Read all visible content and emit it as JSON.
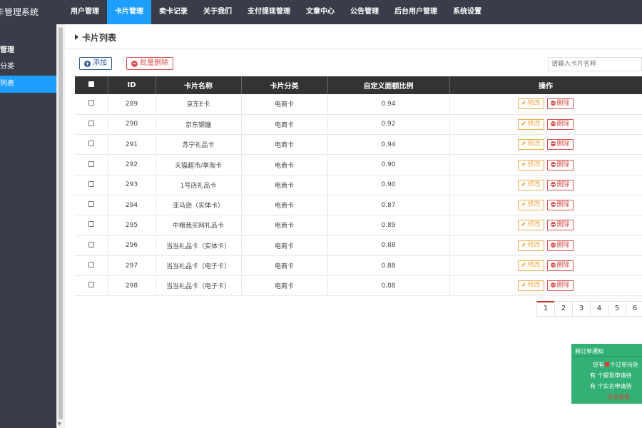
{
  "app": {
    "title": "卡管理系统"
  },
  "nav": {
    "items": [
      {
        "label": "用户管理",
        "active": false
      },
      {
        "label": "卡片管理",
        "active": true
      },
      {
        "label": "卖卡记录",
        "active": false
      },
      {
        "label": "关于我们",
        "active": false
      },
      {
        "label": "支付提现管理",
        "active": false
      },
      {
        "label": "文章中心",
        "active": false
      },
      {
        "label": "公告管理",
        "active": false
      },
      {
        "label": "后台用户管理",
        "active": false
      },
      {
        "label": "系统设置",
        "active": false
      }
    ]
  },
  "sidebar": {
    "group": "管理",
    "items": [
      {
        "label": "分类",
        "active": false
      },
      {
        "label": "列表",
        "active": true
      }
    ]
  },
  "main": {
    "title": "卡片列表",
    "add_label": "添加",
    "batch_delete_label": "批量删除",
    "search_placeholder": "请输入卡片名称"
  },
  "table": {
    "headers": [
      "ID",
      "卡片名称",
      "卡片分类",
      "自定义面额比例",
      "操作"
    ],
    "edit_label": "修改",
    "delete_label": "删除",
    "rows": [
      {
        "id": "289",
        "name": "京东E卡",
        "category": "电商卡",
        "ratio": "0.94"
      },
      {
        "id": "290",
        "name": "京东钢镚",
        "category": "电商卡",
        "ratio": "0.92"
      },
      {
        "id": "291",
        "name": "苏宁礼品卡",
        "category": "电商卡",
        "ratio": "0.94"
      },
      {
        "id": "292",
        "name": "天猫超市/享淘卡",
        "category": "电商卡",
        "ratio": "0.90"
      },
      {
        "id": "293",
        "name": "1号店礼品卡",
        "category": "电商卡",
        "ratio": "0.90"
      },
      {
        "id": "294",
        "name": "亚马逊（实体卡）",
        "category": "电商卡",
        "ratio": "0.87"
      },
      {
        "id": "295",
        "name": "中粮我买网礼品卡",
        "category": "电商卡",
        "ratio": "0.89"
      },
      {
        "id": "296",
        "name": "当当礼品卡（实体卡）",
        "category": "电商卡",
        "ratio": "0.88"
      },
      {
        "id": "297",
        "name": "当当礼品卡（电子卡）",
        "category": "电商卡",
        "ratio": "0.88"
      },
      {
        "id": "298",
        "name": "当当礼品卡（电子卡）",
        "category": "电商卡",
        "ratio": "0.88"
      }
    ]
  },
  "pagination": {
    "pages": [
      "1",
      "2",
      "3",
      "4",
      "5",
      "6"
    ],
    "current": "1"
  },
  "notice": {
    "title": "新订单通知",
    "line1_pre": "您有",
    "line1_post": "个订单待处",
    "line2_pre": "有",
    "line2_post": "个提现申请待",
    "line3_pre": "有",
    "line3_post": "个实名申请待",
    "link": "点击查看"
  }
}
